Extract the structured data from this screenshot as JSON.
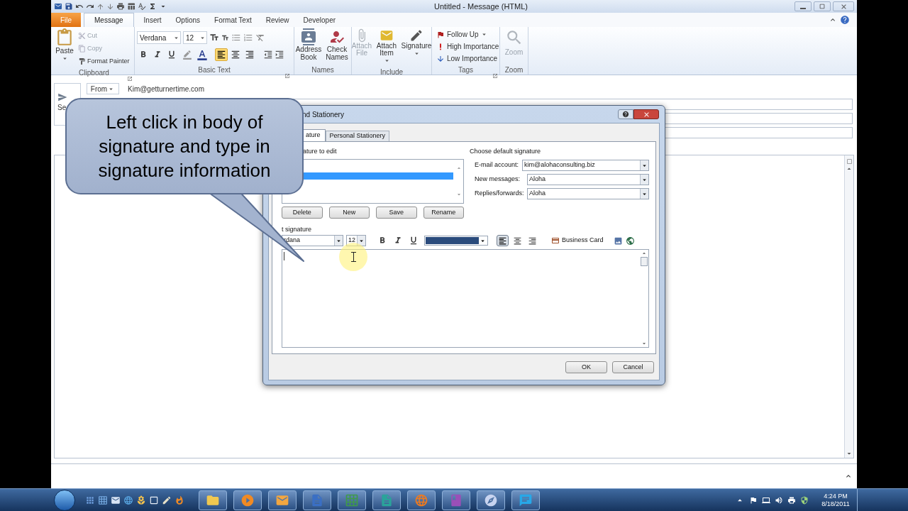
{
  "window": {
    "title": "Untitled - Message (HTML)"
  },
  "ribbon_tabs": [
    {
      "label": "File",
      "kind": "file",
      "selected": false
    },
    {
      "label": "Message",
      "kind": "tab",
      "selected": true
    },
    {
      "label": "Insert",
      "kind": "tab",
      "selected": false
    },
    {
      "label": "Options",
      "kind": "tab",
      "selected": false
    },
    {
      "label": "Format Text",
      "kind": "tab",
      "selected": false
    },
    {
      "label": "Review",
      "kind": "tab",
      "selected": false
    },
    {
      "label": "Developer",
      "kind": "tab",
      "selected": false
    }
  ],
  "clipboard": {
    "label": "Clipboard",
    "paste": "Paste",
    "items": [
      {
        "label": "Cut",
        "disabled": true
      },
      {
        "label": "Copy",
        "disabled": true
      },
      {
        "label": "Format Painter",
        "disabled": false
      }
    ]
  },
  "basic_text": {
    "label": "Basic Text",
    "font": "Verdana",
    "size": "12",
    "alignment": [
      {
        "selected": true
      },
      {
        "selected": false
      },
      {
        "selected": false
      }
    ]
  },
  "names": {
    "label": "Names",
    "buttons": [
      {
        "label": "Address Book"
      },
      {
        "label": "Check Names"
      }
    ]
  },
  "include": {
    "label": "Include",
    "buttons": [
      {
        "label": "Attach File",
        "disabled": true,
        "dropdown": false
      },
      {
        "label": "Attach Item",
        "disabled": false,
        "dropdown": true
      },
      {
        "label": "Signature",
        "disabled": false,
        "dropdown": true
      }
    ]
  },
  "tags": {
    "label": "Tags",
    "items": [
      {
        "label": "Follow Up",
        "kind": "flag",
        "dropdown": true
      },
      {
        "label": "High Importance",
        "kind": "high"
      },
      {
        "label": "Low Importance",
        "kind": "low"
      }
    ]
  },
  "zoom": {
    "label": "Zoom",
    "button": "Zoom",
    "disabled": true
  },
  "message": {
    "send": "Se",
    "from": "From",
    "from_address": "Kim@getturnertime.com"
  },
  "dialog": {
    "title": "nd Stationery",
    "tabs": [
      {
        "label": "ature",
        "selected": true
      },
      {
        "label": "Personal Stationery",
        "selected": false
      }
    ],
    "list_label": "ature to edit",
    "signatures": [
      {
        "selected": true
      }
    ],
    "buttons": [
      "Delete",
      "New",
      "Save",
      "Rename"
    ],
    "defaults_heading": "Choose default signature",
    "defaults": [
      {
        "label": "E-mail account:",
        "value": "kim@alohaconsulting.biz"
      },
      {
        "label": "New messages:",
        "value": "Aloha"
      },
      {
        "label": "Replies/forwards:",
        "value": "Aloha"
      }
    ],
    "edit_label": "t signature",
    "font": "rdana",
    "size": "12",
    "color": "#2a4b7c",
    "alignment": [
      {
        "selected": true
      },
      {
        "selected": false
      },
      {
        "selected": false
      }
    ],
    "business_card": "Business Card",
    "ok": "OK",
    "cancel": "Cancel"
  },
  "callout": {
    "text": "Left click in body of signature and type in signature information"
  },
  "taskbar": {
    "quick_launch": [
      {
        "kind": "apps"
      },
      {
        "kind": "grid"
      },
      {
        "kind": "mail"
      },
      {
        "kind": "globe"
      },
      {
        "kind": "flower"
      },
      {
        "kind": "window"
      },
      {
        "kind": "pencil"
      },
      {
        "kind": "flame"
      }
    ],
    "pinned": [
      {
        "kind": "folder"
      },
      {
        "kind": "media"
      },
      {
        "kind": "mail"
      },
      {
        "kind": "document"
      },
      {
        "kind": "spreadsheet"
      },
      {
        "kind": "publisher"
      },
      {
        "kind": "browser"
      },
      {
        "kind": "notebook"
      },
      {
        "kind": "compass"
      },
      {
        "kind": "chat"
      }
    ],
    "time": "4:24 PM",
    "date": "8/18/2011"
  }
}
